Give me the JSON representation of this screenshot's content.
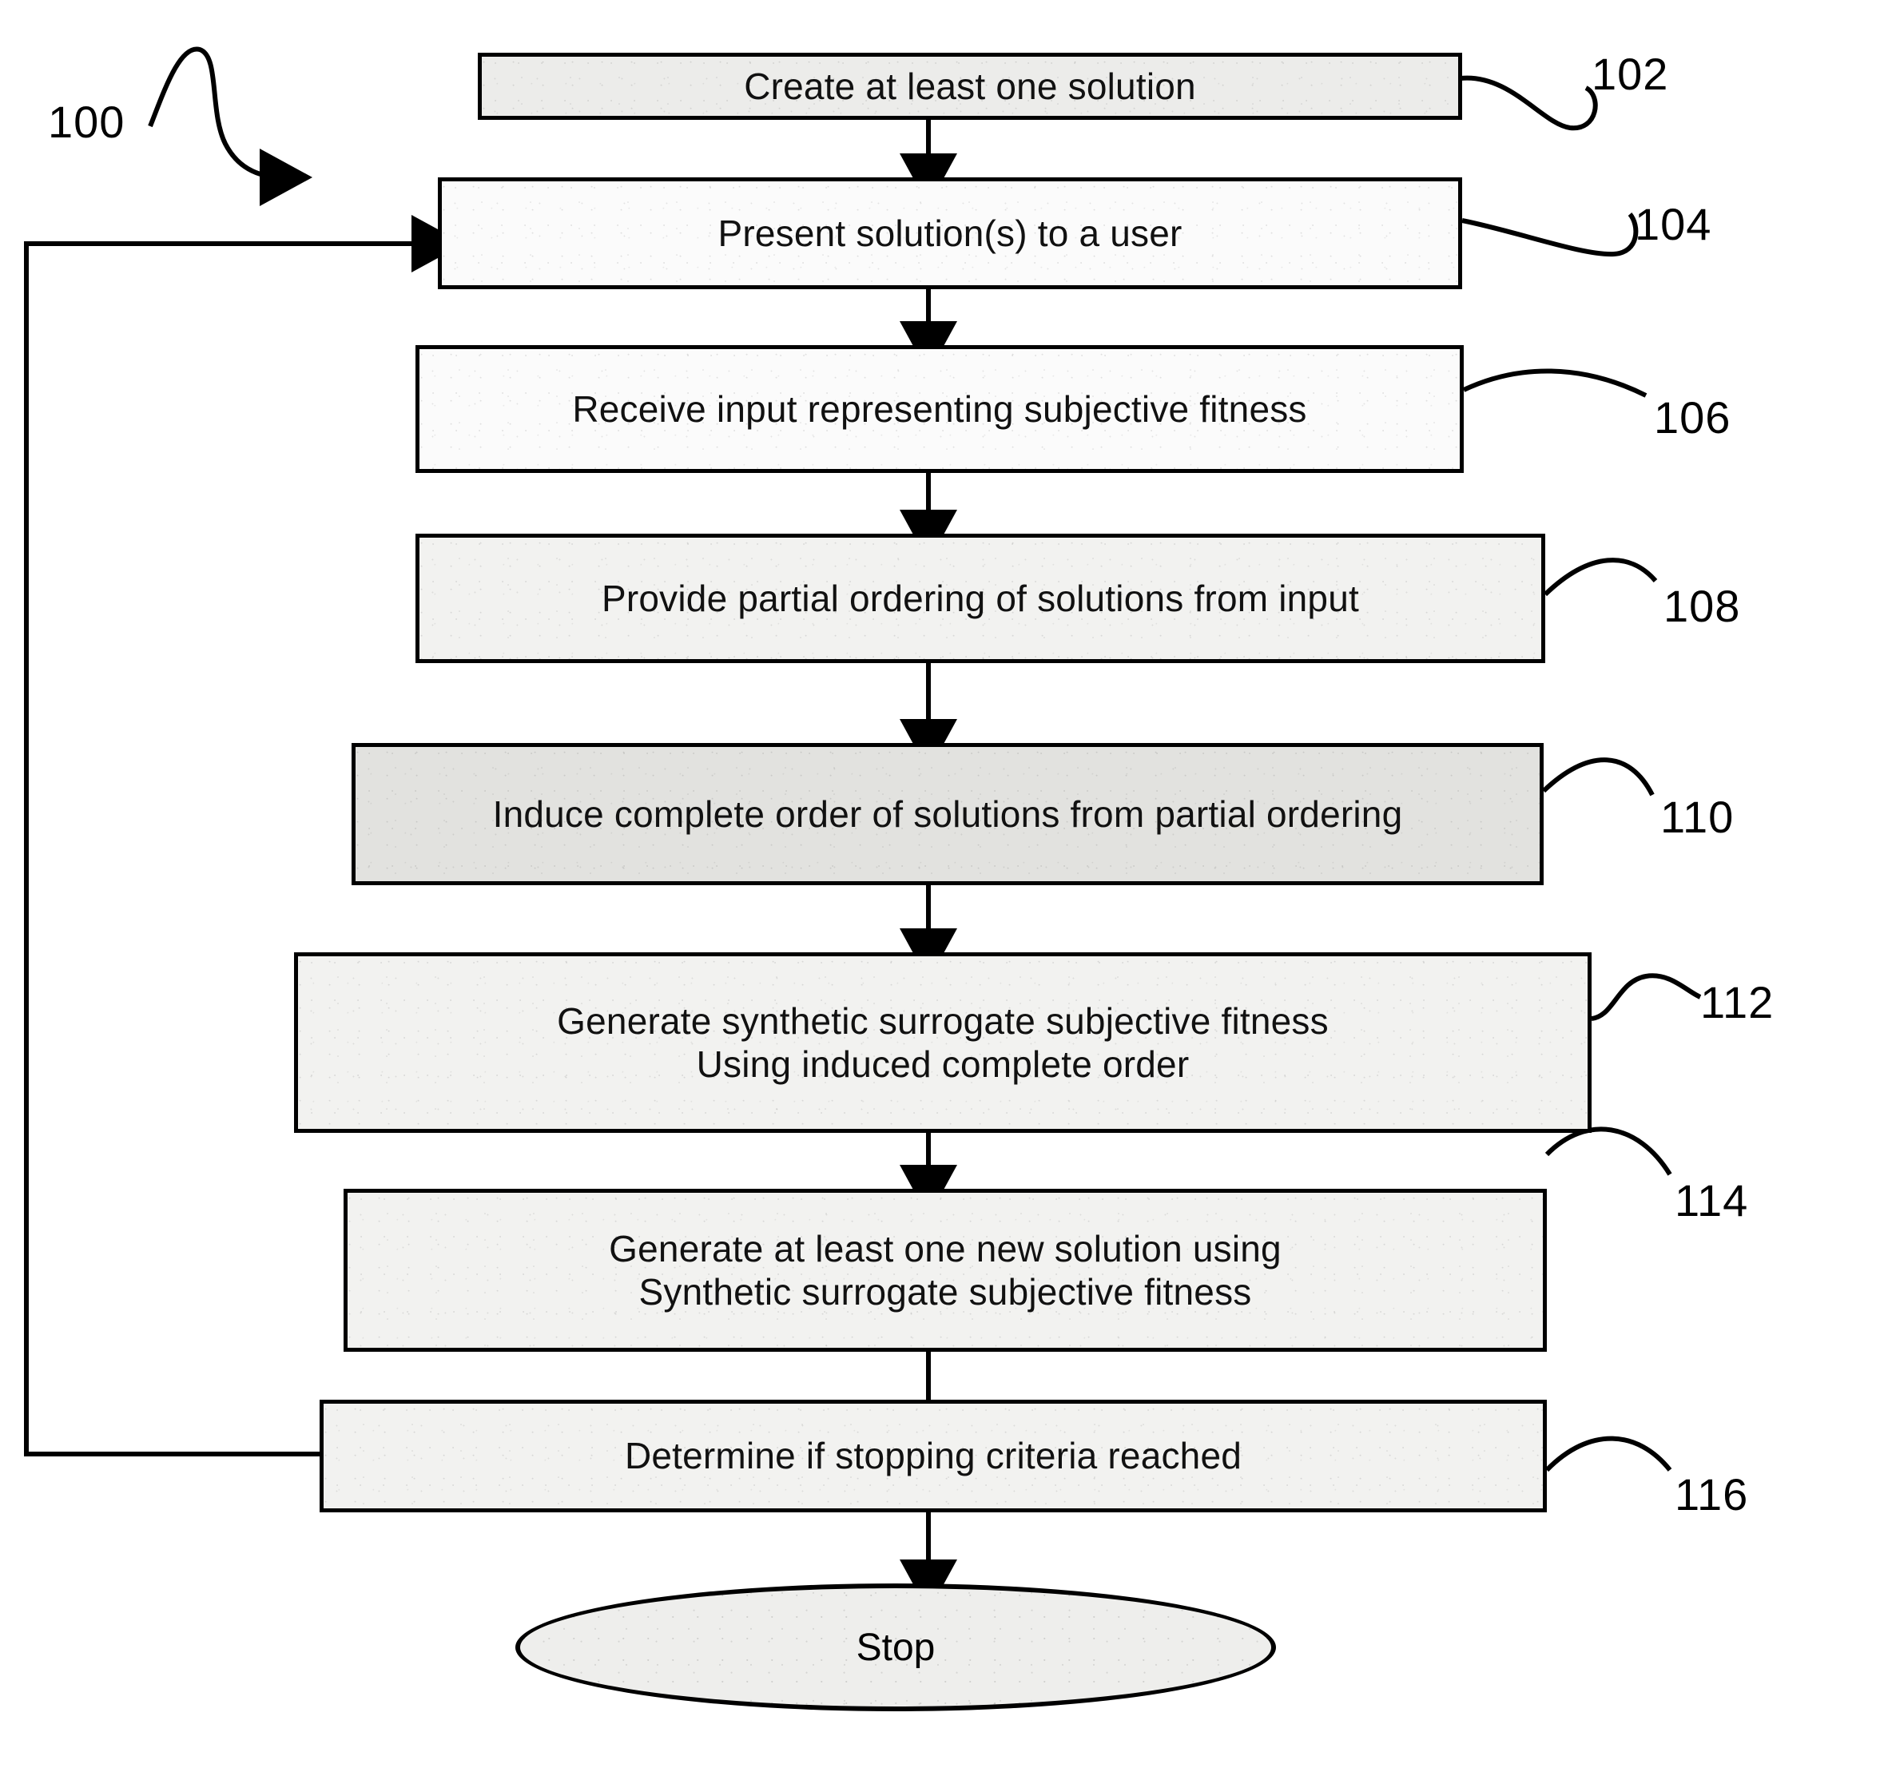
{
  "figure": {
    "figure_ref": "100",
    "stop_label": "Stop"
  },
  "steps": [
    {
      "ref": "102",
      "text": "Create at least one solution"
    },
    {
      "ref": "104",
      "text": "Present solution(s) to a user"
    },
    {
      "ref": "106",
      "text": "Receive input representing subjective fitness"
    },
    {
      "ref": "108",
      "text": "Provide partial ordering of solutions from input"
    },
    {
      "ref": "110",
      "text": "Induce complete order of solutions from partial ordering"
    },
    {
      "ref": "112",
      "text": "Generate synthetic surrogate subjective fitness\nUsing induced complete order"
    },
    {
      "ref": "114",
      "text": "Generate at least one new solution using\nSynthetic surrogate subjective fitness"
    },
    {
      "ref": "116",
      "text": "Determine if stopping criteria reached"
    }
  ]
}
